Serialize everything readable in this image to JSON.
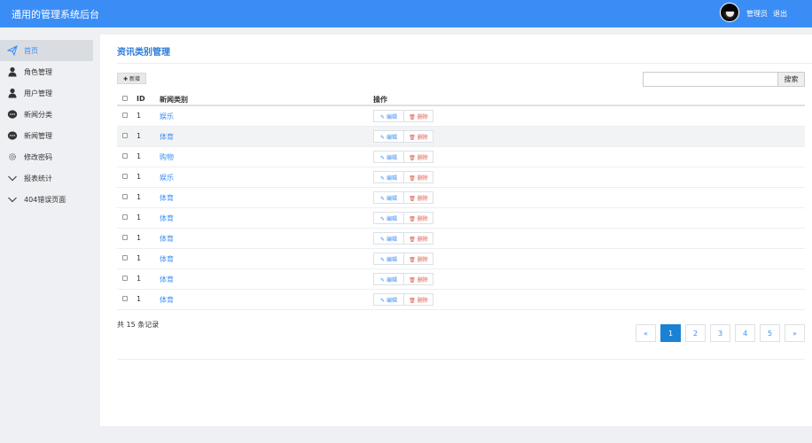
{
  "header": {
    "app_title": "通用的管理系统后台",
    "user_label": "管理员",
    "logout_label": "退出"
  },
  "sidebar": {
    "items": [
      {
        "label": "首页",
        "icon": "paper-plane-icon",
        "active": true
      },
      {
        "label": "角色管理",
        "icon": "user-icon"
      },
      {
        "label": "用户管理",
        "icon": "user-icon"
      },
      {
        "label": "新闻分类",
        "icon": "chat-bubble-icon"
      },
      {
        "label": "新闻管理",
        "icon": "chat-bubble-icon"
      },
      {
        "label": "修改密码",
        "icon": "gear-icon"
      },
      {
        "label": "报表统计",
        "icon": "chevron-down-icon"
      },
      {
        "label": "404错误页面",
        "icon": "chevron-down-icon"
      }
    ]
  },
  "main": {
    "title": "资讯类别管理",
    "add_button": "✚ 新增",
    "search": {
      "value": "",
      "button_label": "搜索"
    },
    "table": {
      "headers": {
        "id": "ID",
        "category": "新闻类别",
        "actions": "操作"
      },
      "edit_label": "✎ 编辑",
      "delete_label": "🗑 删除",
      "rows": [
        {
          "id": "1",
          "category": "娱乐"
        },
        {
          "id": "1",
          "category": "体育"
        },
        {
          "id": "1",
          "category": "购物"
        },
        {
          "id": "1",
          "category": "娱乐"
        },
        {
          "id": "1",
          "category": "体育"
        },
        {
          "id": "1",
          "category": "体育"
        },
        {
          "id": "1",
          "category": "体育"
        },
        {
          "id": "1",
          "category": "体育"
        },
        {
          "id": "1",
          "category": "体育"
        },
        {
          "id": "1",
          "category": "体育"
        }
      ]
    },
    "total_text": "共 15 条记录",
    "pagination": {
      "prev": "«",
      "pages": [
        "1",
        "2",
        "3",
        "4",
        "5"
      ],
      "current": "1",
      "next": "»"
    }
  },
  "colors": {
    "topbar": "#3b8df6",
    "link": "#3b8df6",
    "delete": "#e05a4a",
    "active_page": "#1a82d4"
  }
}
